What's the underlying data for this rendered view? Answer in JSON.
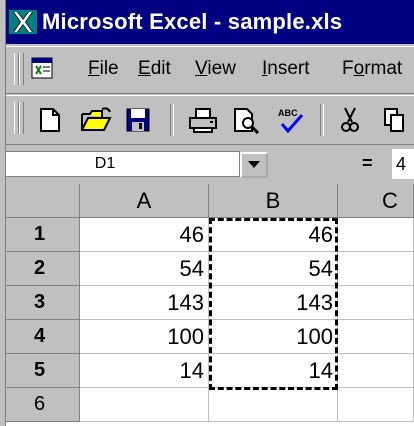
{
  "window": {
    "title": "Microsoft Excel - sample.xls"
  },
  "menu": {
    "items": [
      {
        "label": "File",
        "accel": "F",
        "rest": "ile"
      },
      {
        "label": "Edit",
        "accel": "E",
        "rest": "dit"
      },
      {
        "label": "View",
        "accel": "V",
        "rest": "iew"
      },
      {
        "label": "Insert",
        "accel": "I",
        "rest": "nsert"
      },
      {
        "label": "Format",
        "pre": "F",
        "accel": "o",
        "rest": "rmat"
      }
    ]
  },
  "toolbar": {
    "buttons": [
      "new-icon",
      "open-icon",
      "save-icon",
      "print-icon",
      "print-preview-icon",
      "spelling-icon",
      "cut-icon",
      "copy-icon"
    ]
  },
  "formula_bar": {
    "name_box": "D1",
    "equals": "=",
    "value": "4"
  },
  "sheet": {
    "columns": [
      "A",
      "B",
      "C"
    ],
    "rows": [
      {
        "num": "1",
        "a": "46",
        "b": "46"
      },
      {
        "num": "2",
        "a": "54",
        "b": "54"
      },
      {
        "num": "3",
        "a": "143",
        "b": "143"
      },
      {
        "num": "4",
        "a": "100",
        "b": "100"
      },
      {
        "num": "5",
        "a": "14",
        "b": "14"
      },
      {
        "num": "6",
        "a": "",
        "b": ""
      }
    ],
    "copy_range": "B1:B5"
  },
  "colors": {
    "title_bar": "#000080",
    "chrome": "#c0c0c0"
  }
}
